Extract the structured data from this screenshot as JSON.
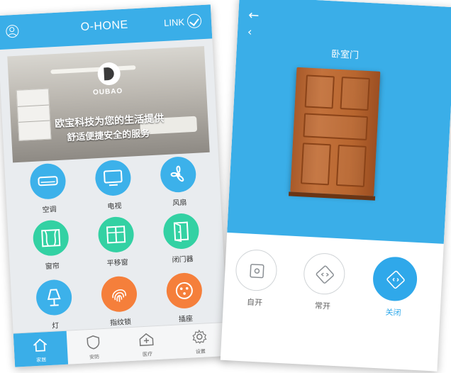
{
  "left_app": {
    "title": "O-HONE",
    "link_label": "LINK",
    "banner": {
      "brand": "OUBAO",
      "line1": "欧宝科技为您的生活提供",
      "line2": "舒适便捷安全的服务"
    },
    "devices": [
      {
        "label": "空调",
        "icon": "air-conditioner-icon",
        "color": "blue"
      },
      {
        "label": "电视",
        "icon": "tv-icon",
        "color": "blue"
      },
      {
        "label": "风扇",
        "icon": "fan-icon",
        "color": "blue"
      },
      {
        "label": "窗帘",
        "icon": "curtain-icon",
        "color": "green"
      },
      {
        "label": "平移窗",
        "icon": "sliding-window-icon",
        "color": "green"
      },
      {
        "label": "闭门器",
        "icon": "door-closer-icon",
        "color": "green"
      },
      {
        "label": "灯",
        "icon": "lamp-icon",
        "color": "blue"
      },
      {
        "label": "指纹锁",
        "icon": "fingerprint-icon",
        "color": "orange"
      },
      {
        "label": "插座",
        "icon": "socket-icon",
        "color": "orange"
      }
    ],
    "tabs": [
      {
        "label": "家居",
        "icon": "home-icon",
        "active": true
      },
      {
        "label": "安防",
        "icon": "shield-icon",
        "active": false
      },
      {
        "label": "医疗",
        "icon": "medical-icon",
        "active": false
      },
      {
        "label": "设置",
        "icon": "gear-icon",
        "active": false
      }
    ],
    "colors": {
      "accent": "#3aaee8",
      "green": "#33d1a3",
      "orange": "#f57f3b"
    }
  },
  "right_app": {
    "title": "卧室门",
    "controls": [
      {
        "label": "自开",
        "icon": "auto-open-icon",
        "active": false
      },
      {
        "label": "常开",
        "icon": "always-open-icon",
        "active": false
      },
      {
        "label": "关闭",
        "icon": "close-door-icon",
        "active": true
      }
    ]
  }
}
